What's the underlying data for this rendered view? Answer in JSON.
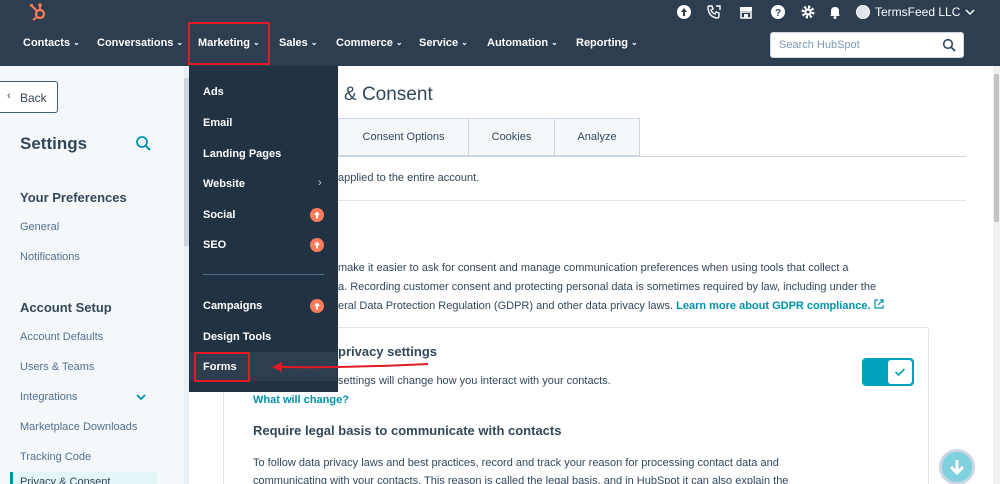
{
  "topbar": {
    "account_name": "TermsFeed LLC",
    "icons": [
      "hubspot-logo",
      "upgrade-icon",
      "calling-icon",
      "marketplace-icon",
      "help-icon",
      "settings-icon",
      "notifications-icon"
    ]
  },
  "nav": {
    "items": [
      "Contacts",
      "Conversations",
      "Marketing",
      "Sales",
      "Commerce",
      "Service",
      "Automation",
      "Reporting"
    ],
    "search_placeholder": "Search HubSpot"
  },
  "dropdown": {
    "items": [
      "Ads",
      "Email",
      "Landing Pages",
      "Website",
      "Social",
      "SEO",
      "Campaigns",
      "Design Tools",
      "Forms"
    ]
  },
  "sidebar": {
    "back_label": "Back",
    "title": "Settings",
    "section1": "Your Preferences",
    "general": "General",
    "notifications": "Notifications",
    "section2": "Account Setup",
    "account_defaults": "Account Defaults",
    "users_teams": "Users & Teams",
    "integrations": "Integrations",
    "marketplace_downloads": "Marketplace Downloads",
    "tracking_code": "Tracking Code",
    "active_item": "Privacy & Consent"
  },
  "main": {
    "title_visible": "& Consent",
    "tabs": [
      "Consent Options",
      "Cookies",
      "Analyze"
    ],
    "subtext": "applied to the entire account.",
    "para_line1": "make it easier to ask for consent and manage communication preferences when using tools that collect a",
    "para_line2": "a. Recording customer consent and protecting personal data is sometimes required by law, including under the",
    "para_line3": "eral Data Protection Regulation (GDPR) and other data privacy laws.",
    "para_link": "Learn more about GDPR compliance.",
    "card_title": "privacy settings",
    "card_desc": "settings will change how you interact with your contacts.",
    "card_link": "What will change?",
    "toggle_state": "on",
    "section_title": "Require legal basis to communicate with contacts",
    "section_line1": "To follow data privacy laws and best practices, record and track your reason for processing contact data and",
    "section_line2": "communicating with your contacts. This reason is called the legal basis, and in HubSpot it can also explain the"
  },
  "colors": {
    "nav_bg": "#2d3e50",
    "dropdown_bg": "#213343",
    "accent": "#0091ae",
    "toggle": "#00a4bd",
    "badge": "#ff7a59",
    "highlight": "#e21a24"
  }
}
